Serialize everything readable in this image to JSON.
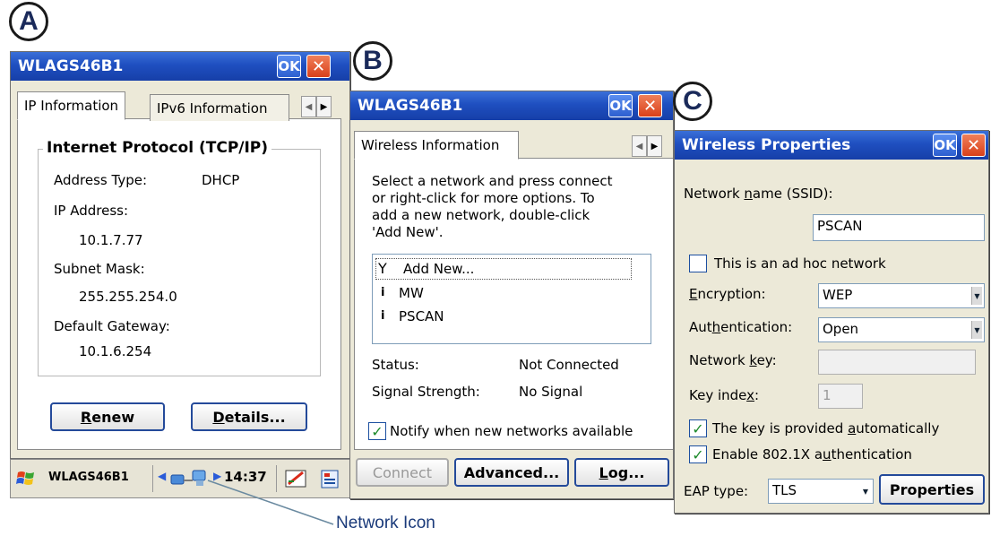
{
  "badges": {
    "a": "A",
    "b": "B",
    "c": "C"
  },
  "callout": {
    "label": "Network Icon",
    "color": "#6a8aa0"
  },
  "win_a": {
    "title": "WLAGS46B1",
    "ok_label": "OK",
    "close_label": "✕",
    "tabs": [
      "IP Information",
      "IPv6 Information"
    ],
    "group_title": "Internet Protocol (TCP/IP)",
    "address_type_label": "Address Type:",
    "address_type_value": "DHCP",
    "ip_label": "IP Address:",
    "ip_value": "10.1.7.77",
    "mask_label": "Subnet Mask:",
    "mask_value": "255.255.254.0",
    "gateway_label": "Default Gateway:",
    "gateway_value": "10.1.6.254",
    "renew_pre": "",
    "renew_u": "R",
    "renew_post": "enew",
    "details_pre": "",
    "details_u": "D",
    "details_post": "etails..."
  },
  "taskbar": {
    "app_label": "WLAGS46B1",
    "time": "14:37"
  },
  "win_b": {
    "title": "WLAGS46B1",
    "ok_label": "OK",
    "close_label": "✕",
    "tab": "Wireless Information",
    "instructions": [
      "Select a network and press connect",
      "or right-click for more options.  To",
      "add a new network, double-click",
      "'Add New'."
    ],
    "networks": [
      "Add New...",
      "MW",
      "PSCAN"
    ],
    "status_label": "Status:",
    "status_value": "Not Connected",
    "signal_label": "Signal Strength:",
    "signal_value": "No Signal",
    "notify_label": "Notify when new networks available",
    "connect_label": "Connect",
    "advanced_label": "Advanced...",
    "log_pre": "",
    "log_u": "L",
    "log_post": "og..."
  },
  "win_c": {
    "title": "Wireless Properties",
    "ok_label": "OK",
    "close_label": "✕",
    "ssid_pre": "Network ",
    "ssid_u": "n",
    "ssid_post": "ame (SSID):",
    "ssid_value": "PSCAN",
    "adhoc_label": "This is an ad hoc network",
    "enc_pre": "",
    "enc_u": "E",
    "enc_post": "ncryption:",
    "enc_value": "WEP",
    "auth_pre": "Aut",
    "auth_u": "h",
    "auth_post": "entication:",
    "auth_value": "Open",
    "key_pre": "Network ",
    "key_u": "k",
    "key_post": "ey:",
    "key_value": "",
    "index_pre": "Key inde",
    "index_u": "x",
    "index_post": ":",
    "index_value": "1",
    "auto_pre": "The key is provided ",
    "auto_u": "a",
    "auto_post": "utomatically",
    "dot1x_pre": "Enable 802.1X a",
    "dot1x_u": "u",
    "dot1x_post": "thentication",
    "eap_label": "EAP type:",
    "eap_value": "TLS",
    "properties_label": "Properties"
  }
}
